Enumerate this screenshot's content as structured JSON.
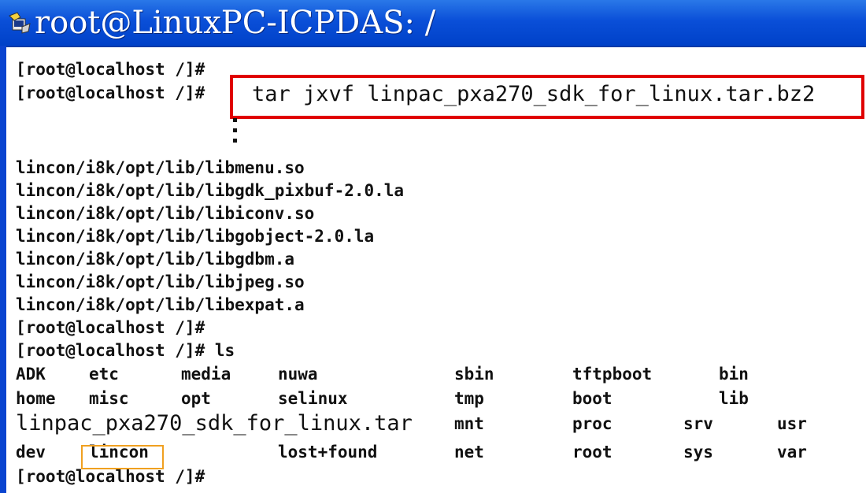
{
  "window": {
    "title": "root@LinuxPC-ICPDAS: /",
    "icon": "putty-icon"
  },
  "terminal": {
    "prompt_lines_top": [
      "[root@localhost /]#",
      "[root@localhost /]#"
    ],
    "command": "tar jxvf linpac_pxa270_sdk_for_linux.tar.bz2",
    "output_lines": [
      "lincon/i8k/opt/lib/libmenu.so",
      "lincon/i8k/opt/lib/libgdk_pixbuf-2.0.la",
      "lincon/i8k/opt/lib/libiconv.so",
      "lincon/i8k/opt/lib/libgobject-2.0.la",
      "lincon/i8k/opt/lib/libgdbm.a",
      "lincon/i8k/opt/lib/libjpeg.so",
      "lincon/i8k/opt/lib/libexpat.a"
    ],
    "prompt_after_output": "[root@localhost /]#",
    "ls_command_line": "[root@localhost /]# ls",
    "ls_rows": [
      [
        "ADK",
        "etc",
        "media",
        "nuwa",
        "sbin",
        "tftpboot",
        "bin"
      ],
      [
        "home",
        "misc",
        "opt",
        "selinux",
        "tmp",
        "boot",
        "lib"
      ],
      [
        "linpac_pxa270_sdk_for_linux.tar",
        "mnt",
        "proc",
        "srv",
        "usr"
      ],
      [
        "dev",
        "lincon",
        "lost+found",
        "net",
        "root",
        "sys",
        "var"
      ]
    ],
    "final_prompt": "[root@localhost /]#"
  },
  "highlights": {
    "command_box_color": "#e00000",
    "lincon_box_color": "#f0a020"
  }
}
